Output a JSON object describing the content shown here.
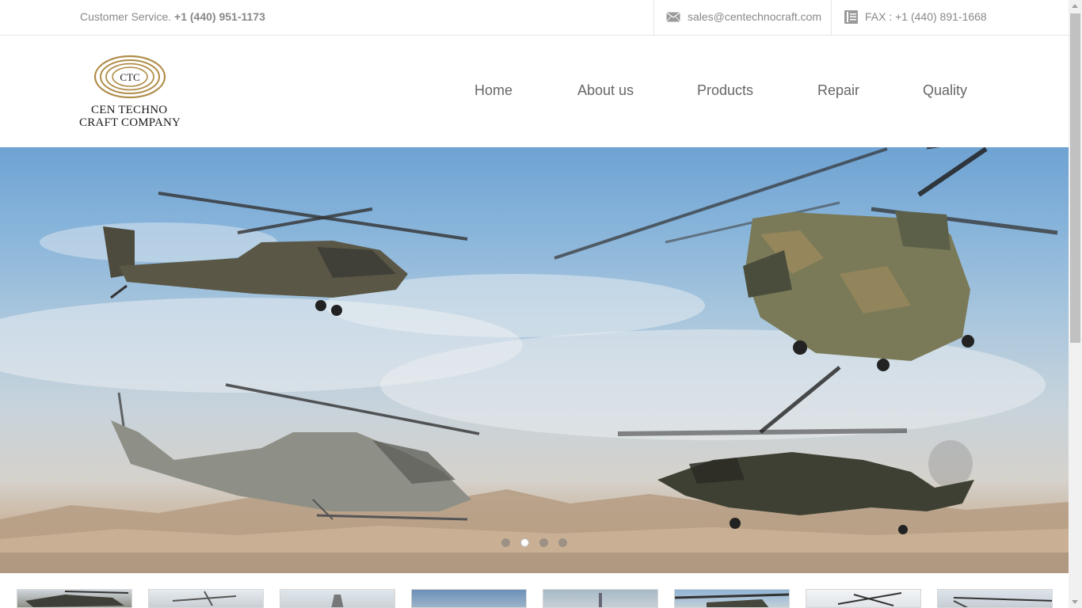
{
  "topbar": {
    "customer_service_label": "Customer Service.",
    "customer_service_phone": "+1 (440) 951-1173",
    "email": "sales@centechnocraft.com",
    "email_icon": "mail-icon",
    "fax": "FAX : +1 (440) 891-1668",
    "fax_icon": "fax-icon"
  },
  "logo": {
    "emblem": "CTC",
    "line1": "CEN TECHNO",
    "line2": "CRAFT COMPANY"
  },
  "nav": {
    "items": [
      {
        "label": "Home"
      },
      {
        "label": "About us"
      },
      {
        "label": "Products"
      },
      {
        "label": "Repair"
      },
      {
        "label": "Quality"
      }
    ]
  },
  "slider": {
    "slide_count": 4,
    "active_index": 1
  },
  "thumbnails": {
    "count": 8
  },
  "colors": {
    "text_muted": "#888888",
    "nav_text": "#666666",
    "border": "#e6e6e6",
    "logo_gold": "#b08d4a"
  }
}
